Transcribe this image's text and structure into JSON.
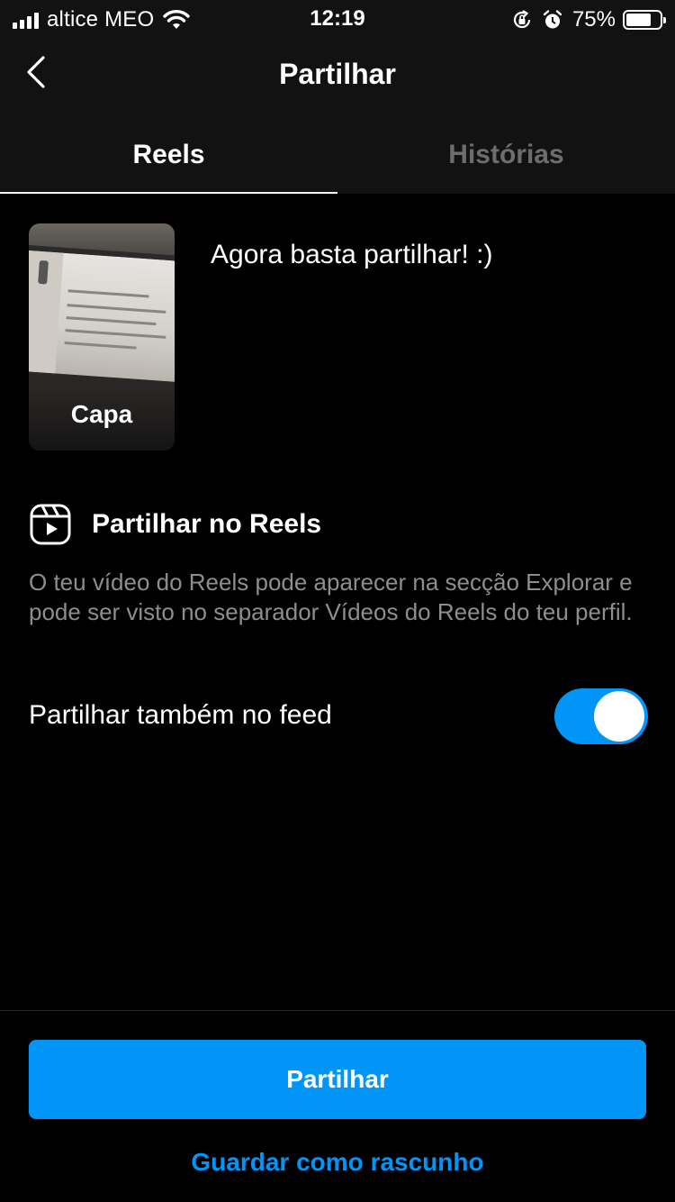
{
  "status_bar": {
    "carrier": "altice MEO",
    "time": "12:19",
    "battery_percent": "75%",
    "battery_level": 0.75,
    "icons": [
      "signal-icon",
      "wifi-icon",
      "orientation-lock-icon",
      "alarm-icon",
      "battery-icon"
    ]
  },
  "header": {
    "title": "Partilhar",
    "back_icon": "chevron-left-icon"
  },
  "tabs": [
    {
      "label": "Reels",
      "active": true
    },
    {
      "label": "Histórias",
      "active": false
    }
  ],
  "post": {
    "cover_label": "Capa",
    "caption": "Agora basta partilhar! :)"
  },
  "reels_section": {
    "icon": "reels-icon",
    "title": "Partilhar no Reels",
    "description": "O teu vídeo do Reels pode aparecer na secção Explorar e pode ser visto no separador Vídeos do Reels do teu perfil."
  },
  "feed_option": {
    "label": "Partilhar também no feed",
    "enabled": true
  },
  "actions": {
    "share_label": "Partilhar",
    "draft_label": "Guardar como rascunho"
  },
  "colors": {
    "accent": "#0095f6",
    "background": "#000000",
    "header_background": "#121212",
    "muted_text": "#8e8e8e"
  }
}
